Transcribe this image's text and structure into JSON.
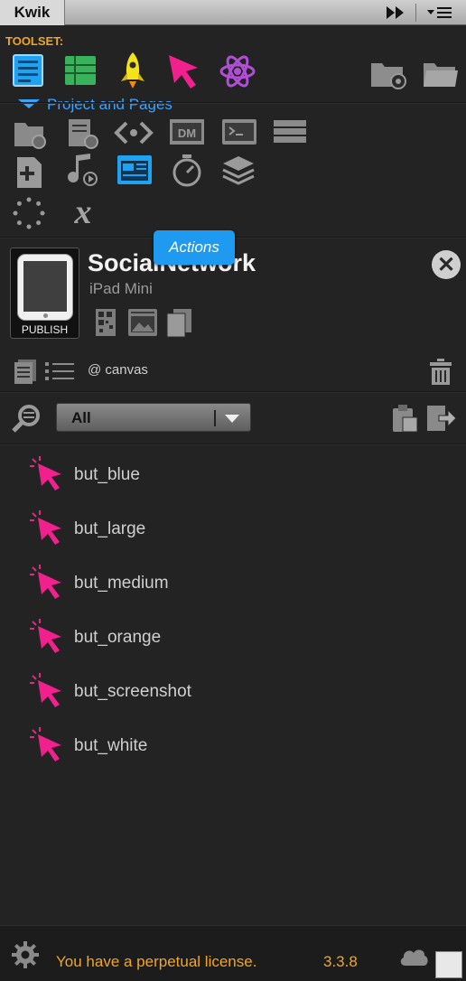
{
  "panel": {
    "tab_title": "Kwik"
  },
  "toolset": {
    "label": "TOOLSET:",
    "tools": [
      "project-icon",
      "list-icon",
      "rocket-icon",
      "cursor-icon",
      "atom-icon"
    ],
    "right_tools": [
      "folder-gear-icon",
      "folder-icon"
    ]
  },
  "section": {
    "title": "Project and Pages",
    "tooltip": "Actions"
  },
  "project": {
    "name": "SocialNetwork",
    "device": "iPad Mini",
    "publish_label": "PUBLISH",
    "canvas_label": "@ canvas"
  },
  "filter": {
    "selected": "All"
  },
  "buttons_list": [
    "but_blue",
    "but_large",
    "but_medium",
    "but_orange",
    "but_screenshot",
    "but_white"
  ],
  "footer": {
    "license_text": "You have a perpetual license.",
    "version": "3.3.8"
  },
  "colors": {
    "accent_orange": "#f2a622",
    "accent_blue": "#3da4ff",
    "cursor_pink": "#f0208c",
    "background": "#232323"
  }
}
